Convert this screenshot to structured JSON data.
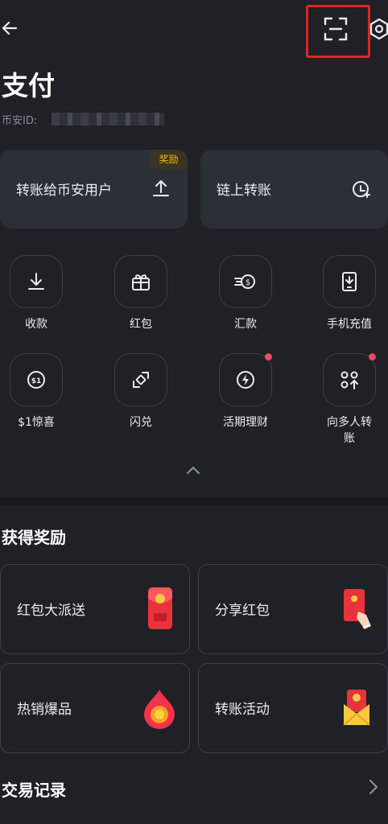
{
  "header": {
    "back_icon": "arrow-left-icon",
    "scan_icon": "scan-icon",
    "settings_icon": "hexagon-settings-icon"
  },
  "page": {
    "title": "支付",
    "uid_label": "币安ID:"
  },
  "cards": {
    "transfer": {
      "label": "转账给币安用户",
      "badge": "奖励",
      "icon": "upload-arrow-icon"
    },
    "onchain": {
      "label": "链上转账",
      "icon": "chain-transfer-icon"
    }
  },
  "quick_actions": [
    {
      "label": "收款",
      "icon": "download-icon"
    },
    {
      "label": "红包",
      "icon": "gift-icon"
    },
    {
      "label": "汇款",
      "icon": "remit-dollar-icon"
    },
    {
      "label": "手机充值",
      "icon": "phone-topup-icon"
    },
    {
      "label": "$1惊喜",
      "icon": "dollar-coin-icon"
    },
    {
      "label": "闪兑",
      "icon": "swap-icon"
    },
    {
      "label": "活期理财",
      "icon": "lightning-icon"
    },
    {
      "label": "向多人转账",
      "icon": "multi-transfer-icon"
    }
  ],
  "rewards": {
    "title": "获得奖励",
    "items": [
      {
        "label": "红包大派送",
        "icon": "red-envelope-icon"
      },
      {
        "label": "分享红包",
        "icon": "share-envelope-icon"
      },
      {
        "label": "热销爆品",
        "icon": "hot-fire-icon"
      },
      {
        "label": "转账活动",
        "icon": "transfer-activity-icon"
      }
    ]
  },
  "history": {
    "title": "交易记录"
  },
  "colors": {
    "background": "#1f2126",
    "card": "#2b2f36",
    "accent": "#f0b90b",
    "alert": "#f6465d",
    "highlight_box": "#e02424"
  }
}
